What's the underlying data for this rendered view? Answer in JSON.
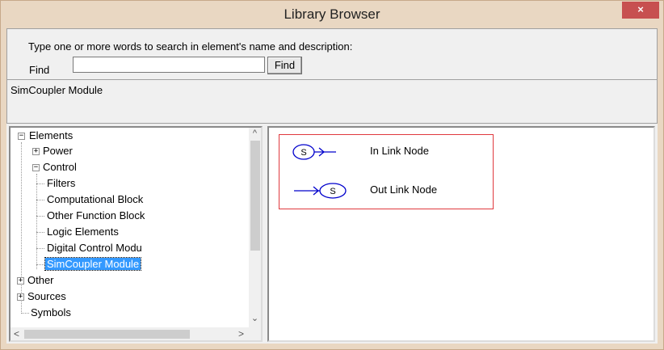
{
  "window": {
    "title": "Library Browser",
    "close_label": "×"
  },
  "search": {
    "instruction": "Type one or more words to search in element's name and  description:",
    "find_label": "Find",
    "find_value": "",
    "find_button": "Find"
  },
  "description": {
    "text": "SimCoupler Module"
  },
  "tree": {
    "root": {
      "label": "Elements",
      "toggle": "−"
    },
    "items": [
      {
        "label": "Power",
        "toggle": "+"
      },
      {
        "label": "Control",
        "toggle": "−"
      },
      {
        "label": "Filters"
      },
      {
        "label": "Computational Block"
      },
      {
        "label": "Other Function Block"
      },
      {
        "label": "Logic Elements"
      },
      {
        "label": "Digital Control Modu"
      },
      {
        "label": "SimCoupler Module"
      },
      {
        "label": "Other",
        "toggle": "+"
      },
      {
        "label": "Sources",
        "toggle": "+"
      },
      {
        "label": "Symbols"
      }
    ]
  },
  "preview": {
    "items": [
      {
        "symbol": "S",
        "label": "In Link Node"
      },
      {
        "symbol": "S",
        "label": "Out Link Node"
      }
    ],
    "border_color": "#e0393e",
    "symbol_color": "#0000cc"
  },
  "scroll": {
    "up": "^",
    "down": "⌄",
    "left": "<",
    "right": ">"
  }
}
